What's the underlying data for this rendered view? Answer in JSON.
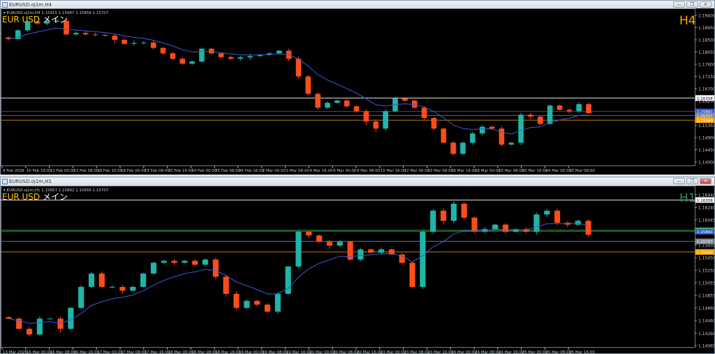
{
  "windows": [
    {
      "title": "EURUSD.oj1m,H4",
      "info": "EURUSD.oj1m,H4  1.15915 1.15987 1.15656 1.15707",
      "symbol_label": "EUR USD",
      "symbol_suffix": "メイン",
      "timeframe": "H4",
      "timeframe_color": "#FFA500",
      "buttons": {
        "minimize": "—",
        "restore": "❐",
        "close": "✕"
      }
    },
    {
      "title": "EURUSD.oj1m,H1",
      "info": "EURUSD.oj1m,H1  1.15857 1.15892 1.15656 1.15707",
      "symbol_label": "EUR USD",
      "symbol_suffix": "メイン",
      "timeframe": "H1",
      "timeframe_color": "#2E8B57",
      "buttons": {
        "minimize": "—",
        "restore": "❐",
        "close": "✕"
      }
    }
  ],
  "colors": {
    "bull": "#1fb5a8",
    "bear": "#ff4d1a",
    "ma": "#3b5bdb",
    "background": "#000000",
    "axis_text": "#c8c8c8"
  },
  "chart_data": [
    {
      "type": "candlestick",
      "title": "EURUSD.oj1m,H4",
      "ylim": [
        1.14,
        1.194
      ],
      "y_ticks": [
        "1.19400",
        "1.18950",
        "1.18500",
        "1.18050",
        "1.17600",
        "1.17150",
        "1.16700",
        "1.16250",
        "1.15350",
        "1.14900",
        "1.14450",
        "1.14000"
      ],
      "x_ticks": [
        "9 Feb 2026",
        "10 Feb 16:00",
        "12 Feb 00:00",
        "13 Feb 08:00",
        "16 Feb 16:00",
        "18 Feb 00:00",
        "19 Feb 08:00",
        "20 Feb 16:00",
        "24 Feb 00:00",
        "25 Feb 08:00",
        "26 Feb 16:00",
        "2 Mar 00:00",
        "3 Mar 08:00",
        "4 Mar 16:00",
        "6 Mar 00:00",
        "9 Mar 08:00",
        "10 Mar 16:00",
        "12 Mar 00:00",
        "13 Mar 08:00",
        "16 Mar 16:00",
        "18 Mar 00:00",
        "19 Mar 08:00",
        "20 Mar 16:00",
        "24 Mar 00:00",
        "25 Mar 08:00"
      ],
      "closes": [
        1.1853,
        1.1885,
        1.1917,
        1.191,
        1.1917,
        1.192,
        1.187,
        1.1875,
        1.187,
        1.1868,
        1.1865,
        1.185,
        1.1835,
        1.1838,
        1.184,
        1.182,
        1.18,
        1.178,
        1.1762,
        1.177,
        1.1817,
        1.18,
        1.1786,
        1.178,
        1.1785,
        1.179,
        1.1795,
        1.18,
        1.181,
        1.178,
        1.1715,
        1.1651,
        1.16,
        1.1618,
        1.1626,
        1.1605,
        1.1587,
        1.1549,
        1.1523,
        1.1587,
        1.1634,
        1.1626,
        1.16,
        1.1562,
        1.1523,
        1.1471,
        1.143,
        1.1471,
        1.1505,
        1.153,
        1.1523,
        1.1464,
        1.1471,
        1.1574,
        1.1567,
        1.154,
        1.1608,
        1.1592,
        1.1587,
        1.1613,
        1.158
      ],
      "levels": [
        {
          "value": "1.16358",
          "color": "#ffffff"
        },
        {
          "value": "1.15861",
          "color": "#3b5bdb"
        },
        {
          "value": "1.15707",
          "color": "#808890"
        },
        {
          "value": "1.15540",
          "color": "#ffa500"
        }
      ]
    },
    {
      "type": "candlestick",
      "title": "EURUSD.oj1m,H1",
      "ylim": [
        1.14065,
        1.1644
      ],
      "y_ticks": [
        "1.16440",
        "1.16240",
        "1.16045",
        "1.15850",
        "1.15650",
        "1.15450",
        "1.15250",
        "1.15055",
        "1.14855",
        "1.14660",
        "1.14460",
        "1.14260",
        "1.14065"
      ],
      "x_ticks": [
        "13 Mar 2026",
        "16 Mar 00:00",
        "16 Mar 08:00",
        "16 Mar 16:00",
        "17 Mar 00:00",
        "17 Mar 08:00",
        "17 Mar 16:00",
        "18 Mar 00:00",
        "18 Mar 08:00",
        "18 Mar 16:00",
        "19 Mar 00:00",
        "19 Mar 08:00",
        "19 Mar 16:00",
        "20 Mar 00:00",
        "20 Mar 08:00",
        "20 Mar 16:00",
        "23 Mar 00:00",
        "23 Mar 08:00",
        "23 Mar 16:00",
        "24 Mar 00:00",
        "24 Mar 08:00",
        "24 Mar 16:00",
        "25 Mar 00:00",
        "25 Mar 08:00",
        "25 Mar 16:00"
      ],
      "closes": [
        1.1449,
        1.1433,
        1.1424,
        1.1449,
        1.1449,
        1.1433,
        1.1466,
        1.1499,
        1.152,
        1.1499,
        1.1499,
        1.1493,
        1.1499,
        1.152,
        1.1537,
        1.154,
        1.1537,
        1.154,
        1.1534,
        1.1542,
        1.1515,
        1.1488,
        1.1466,
        1.1477,
        1.1471,
        1.146,
        1.1488,
        1.1531,
        1.1586,
        1.158,
        1.157,
        1.1564,
        1.157,
        1.1542,
        1.1558,
        1.1553,
        1.1558,
        1.155,
        1.1537,
        1.1499,
        1.1586,
        1.1619,
        1.1603,
        1.163,
        1.1608,
        1.1586,
        1.159,
        1.1597,
        1.1586,
        1.159,
        1.1586,
        1.1613,
        1.1619,
        1.16,
        1.1597,
        1.1603,
        1.1581
      ],
      "levels": [
        {
          "value": "1.16358",
          "color": "#ffffff"
        },
        {
          "value": "1.15880",
          "color": "#2ecc40"
        },
        {
          "value": "1.15861",
          "color": "#3b5bdb"
        },
        {
          "value": "1.15707",
          "color": "#808890"
        },
        {
          "value": "1.15540",
          "color": "#ffa500"
        }
      ]
    }
  ]
}
